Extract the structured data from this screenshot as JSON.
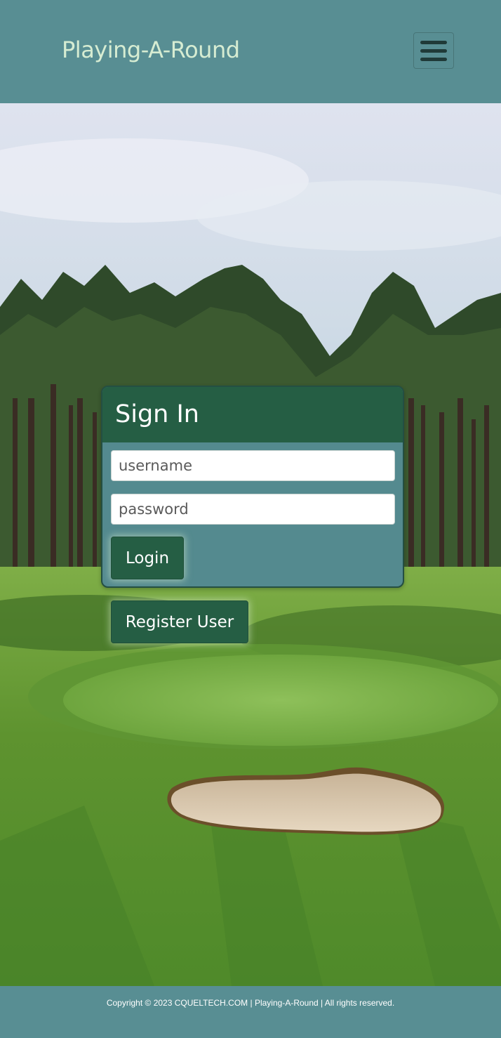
{
  "header": {
    "brand": "Playing-A-Round",
    "menu_icon": "hamburger-menu-icon"
  },
  "hero": {
    "image": "golf-course-background"
  },
  "signin": {
    "title": "Sign In",
    "username_placeholder": "username",
    "password_placeholder": "password",
    "login_label": "Login"
  },
  "register": {
    "label": "Register User"
  },
  "footer": {
    "copyright": "Copyright © 2023 CQUELTECH.COM | Playing-A-Round | All rights reserved."
  },
  "colors": {
    "header_bg": "#588e93",
    "brand_text": "#d6ecd2",
    "card_header": "#255e44",
    "card_body": "#548a8f",
    "button_bg": "#255e44"
  }
}
